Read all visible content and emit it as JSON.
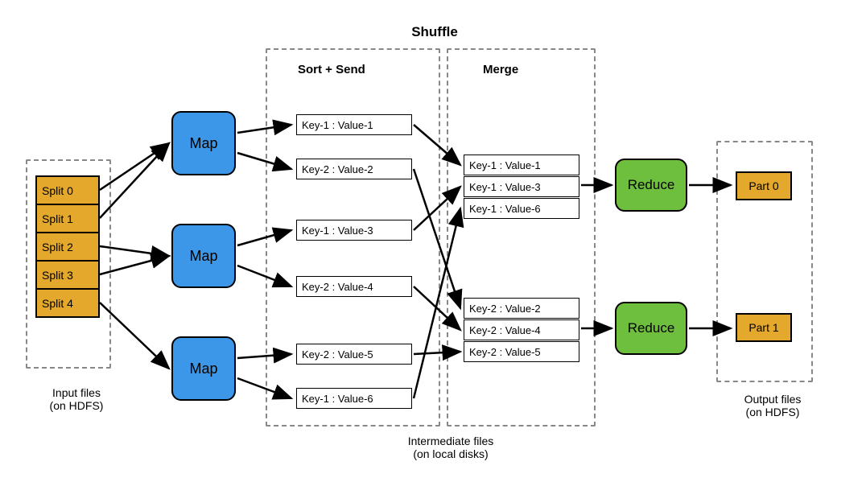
{
  "shuffle_title": "Shuffle",
  "sort_send_title": "Sort + Send",
  "merge_title": "Merge",
  "splits": [
    "Split 0",
    "Split 1",
    "Split 2",
    "Split 3",
    "Split 4"
  ],
  "map_label": "Map",
  "reduce_label": "Reduce",
  "parts": [
    "Part 0",
    "Part 1"
  ],
  "sort_kv": [
    "Key-1 : Value-1",
    "Key-2 : Value-2",
    "Key-1 : Value-3",
    "Key-2 : Value-4",
    "Key-2 : Value-5",
    "Key-1 : Value-6"
  ],
  "merge_group1": [
    "Key-1 : Value-1",
    "Key-1 : Value-3",
    "Key-1 : Value-6"
  ],
  "merge_group2": [
    "Key-2 : Value-2",
    "Key-2 : Value-4",
    "Key-2 : Value-5"
  ],
  "caption_input_1": "Input files",
  "caption_input_2": "(on HDFS)",
  "caption_inter_1": "Intermediate files",
  "caption_inter_2": "(on local disks)",
  "caption_output_1": "Output files",
  "caption_output_2": "(on HDFS)"
}
